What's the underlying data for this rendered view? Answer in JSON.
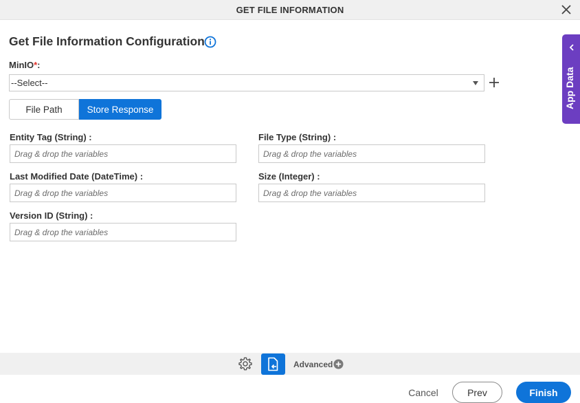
{
  "dialog": {
    "title": "GET FILE INFORMATION",
    "section_title": "Get File Information Configuration"
  },
  "minio": {
    "label": "MinIO",
    "required_mark": "*",
    "label_suffix": ":",
    "selected": "--Select--"
  },
  "tabs": [
    {
      "label": "File Path",
      "active": false
    },
    {
      "label": "Store Response",
      "active": true
    }
  ],
  "fields": [
    {
      "label": "Entity Tag (String) :",
      "placeholder": "Drag & drop the variables"
    },
    {
      "label": "File Type (String) :",
      "placeholder": "Drag & drop the variables"
    },
    {
      "label": "Last Modified Date (DateTime) :",
      "placeholder": "Drag & drop the variables"
    },
    {
      "label": "Size (Integer) :",
      "placeholder": "Drag & drop the variables"
    },
    {
      "label": "Version ID (String) :",
      "placeholder": "Drag & drop the variables"
    }
  ],
  "side_panel": {
    "label": "App Data"
  },
  "toolbar": {
    "advanced_label": "Advanced"
  },
  "footer": {
    "cancel_label": "Cancel",
    "prev_label": "Prev",
    "finish_label": "Finish"
  },
  "colors": {
    "primary": "#0f74d9",
    "app_data": "#6c3ec1",
    "required": "#e0312a"
  },
  "icons": [
    "close-icon",
    "info-icon",
    "chevron-down-icon",
    "plus-icon",
    "chevron-left-icon",
    "gear-icon",
    "file-return-icon",
    "plus-circle-icon"
  ]
}
